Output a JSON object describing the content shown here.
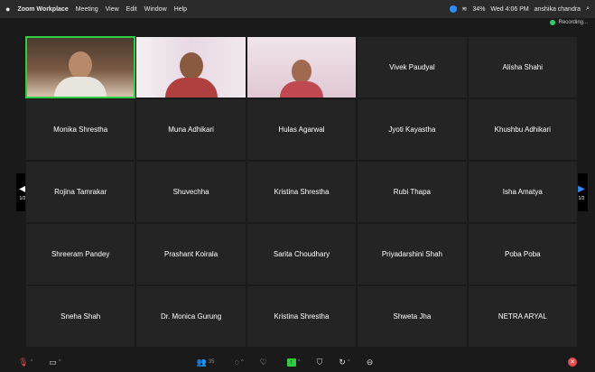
{
  "menubar": {
    "app": "Zoom Workplace",
    "items": [
      "Meeting",
      "View",
      "Edit",
      "Window",
      "Help"
    ],
    "battery": "34%",
    "clock": "Wed 4:06 PM",
    "user": "anshika chandra"
  },
  "recording": {
    "label": "Recording..."
  },
  "gallery": {
    "tiles": [
      {
        "type": "video",
        "name": ""
      },
      {
        "type": "video",
        "name": ""
      },
      {
        "type": "video",
        "name": ""
      },
      {
        "type": "name",
        "name": "Vivek Paudyal"
      },
      {
        "type": "name",
        "name": "Alisha Shahi"
      },
      {
        "type": "name",
        "name": "Monika Shrestha"
      },
      {
        "type": "name",
        "name": "Muna Adhikari"
      },
      {
        "type": "name",
        "name": "Hulas Agarwal"
      },
      {
        "type": "name",
        "name": "Jyoti Kayastha"
      },
      {
        "type": "name",
        "name": "Khushbu Adhikari"
      },
      {
        "type": "name",
        "name": "Rojina Tamrakar"
      },
      {
        "type": "name",
        "name": "Shuvechha"
      },
      {
        "type": "name",
        "name": "Kristina Shrestha"
      },
      {
        "type": "name",
        "name": "Rubi Thapa"
      },
      {
        "type": "name",
        "name": "Isha Amatya"
      },
      {
        "type": "name",
        "name": "Shreeram Pandey"
      },
      {
        "type": "name",
        "name": "Prashant Koirala"
      },
      {
        "type": "name",
        "name": "Sarita Choudhary"
      },
      {
        "type": "name",
        "name": "Priyadarshini Shah"
      },
      {
        "type": "name",
        "name": "Poba Poba"
      },
      {
        "type": "name",
        "name": "Sneha Shah"
      },
      {
        "type": "name",
        "name": "Dr. Monica Gurung"
      },
      {
        "type": "name",
        "name": "Kristina Shrestha"
      },
      {
        "type": "name",
        "name": "Shweta Jha"
      },
      {
        "type": "name",
        "name": "NETRA ARYAL"
      }
    ]
  },
  "pager": {
    "left": "1/2",
    "right": "1/2"
  },
  "toolbar": {
    "participants_count": "35"
  },
  "colors": {
    "active_speaker": "#2ecc40",
    "accent": "#2d8cff",
    "mute": "#e84b4b"
  }
}
